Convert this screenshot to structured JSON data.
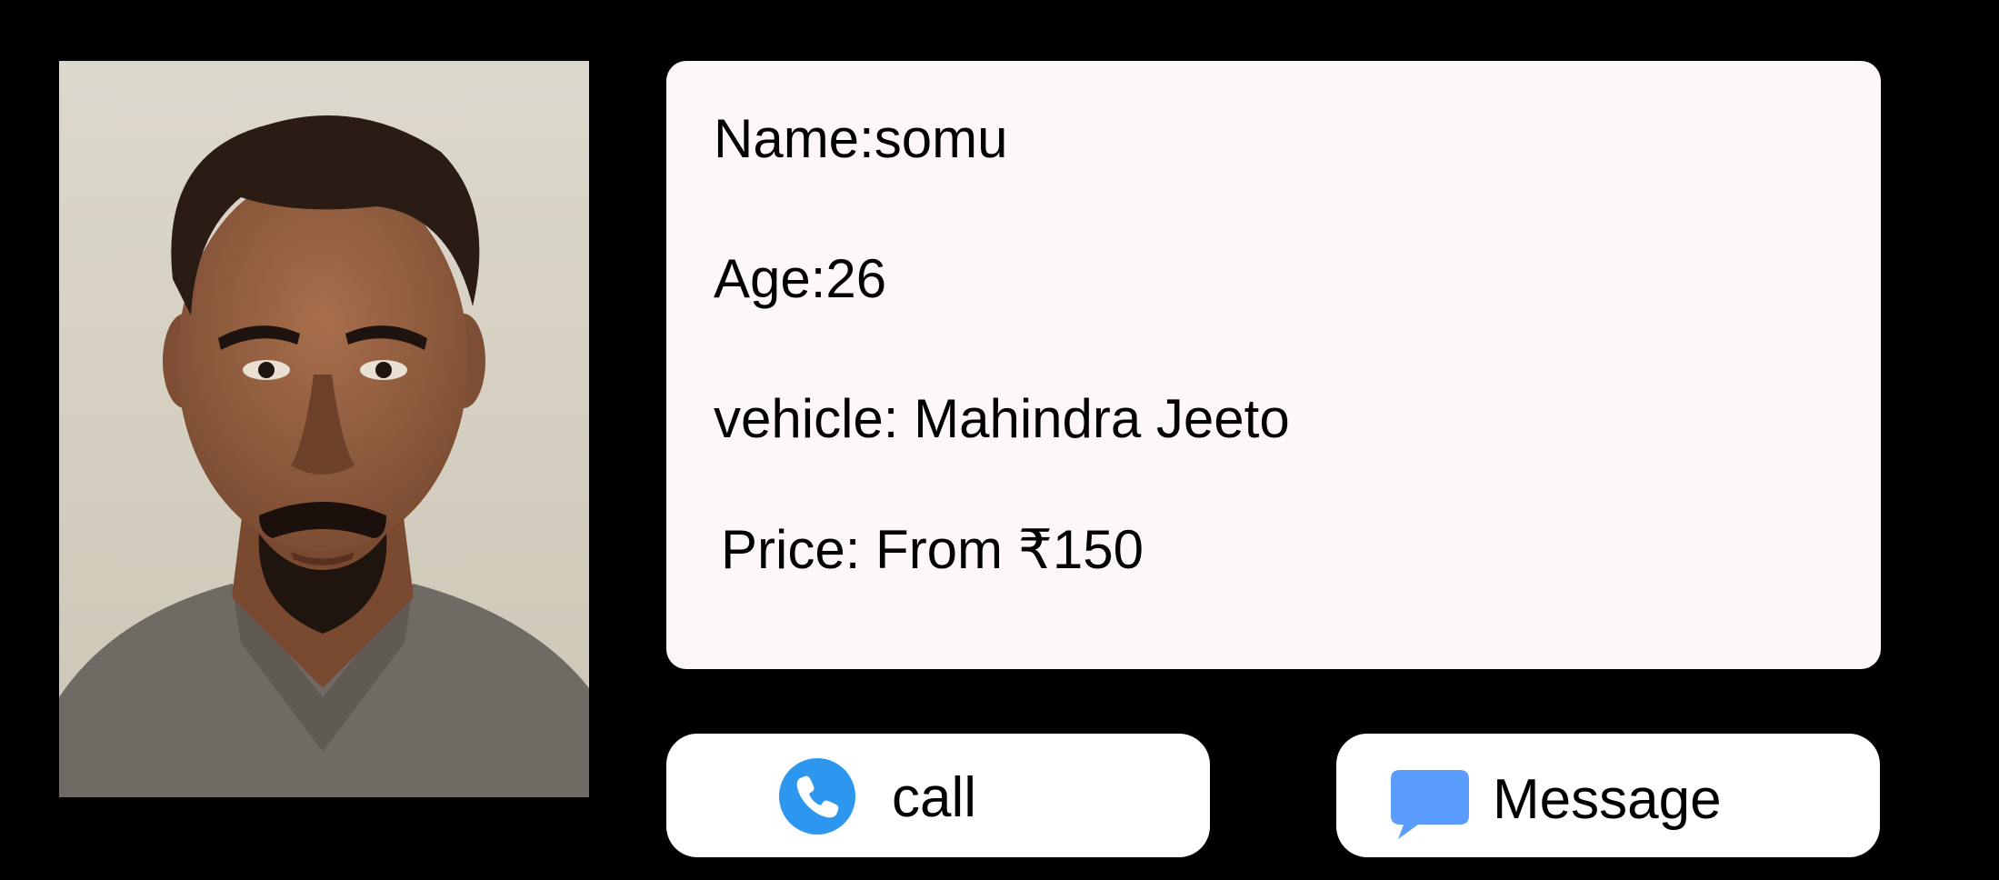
{
  "profile": {
    "photo_alt": "driver photo",
    "name_line": "Name:somu",
    "age_line": "Age:26",
    "vehicle_line": "vehicle: Mahindra Jeeto",
    "price_line": "Price: From ₹150"
  },
  "actions": {
    "call_label": "call",
    "call_icon": "phone-icon",
    "message_label": "Message",
    "message_icon": "chat-bubble-icon"
  },
  "colors": {
    "background": "#000000",
    "card_background": "#fdf8f7",
    "button_background": "#ffffff",
    "call_icon_color": "#2d97f0",
    "message_icon_color": "#5b9cff"
  }
}
